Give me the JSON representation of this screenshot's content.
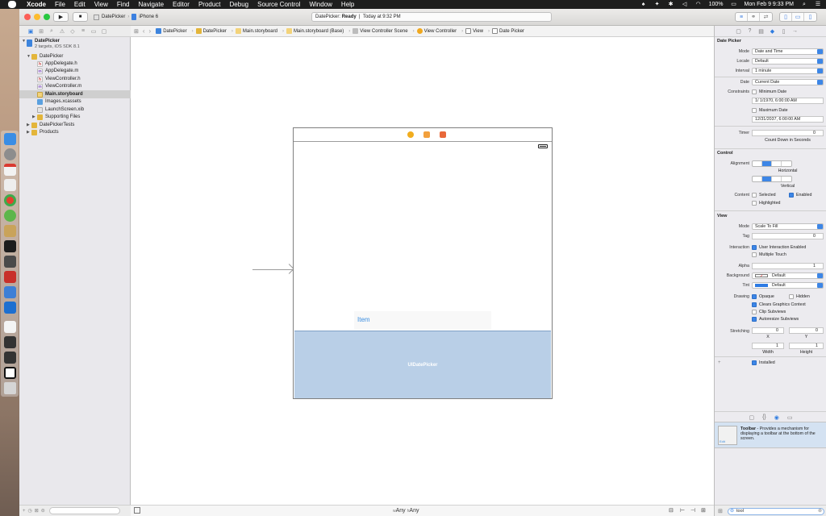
{
  "menubar": {
    "app": "Xcode",
    "items": [
      "File",
      "Edit",
      "View",
      "Find",
      "Navigate",
      "Editor",
      "Product",
      "Debug",
      "Source Control",
      "Window",
      "Help"
    ],
    "battery": "100%",
    "clock": "Mon Feb 9  9:33 PM"
  },
  "toolbar": {
    "scheme": "DatePicker",
    "device": "iPhone 6",
    "status_project": "DatePicker:",
    "status_state": "Ready",
    "status_time": "Today at 9:32 PM"
  },
  "navigator": {
    "project": {
      "name": "DatePicker",
      "subtitle": "2 targets, iOS SDK 8.1"
    },
    "items": [
      {
        "label": "DatePicker",
        "kind": "folder",
        "disclosure": "▼"
      },
      {
        "label": "AppDelegate.h",
        "kind": "h"
      },
      {
        "label": "AppDelegate.m",
        "kind": "m"
      },
      {
        "label": "ViewController.h",
        "kind": "h"
      },
      {
        "label": "ViewController.m",
        "kind": "m"
      },
      {
        "label": "Main.storyboard",
        "kind": "storyboard",
        "selected": true
      },
      {
        "label": "Images.xcassets",
        "kind": "xcassets"
      },
      {
        "label": "LaunchScreen.xib",
        "kind": "xib"
      },
      {
        "label": "Supporting Files",
        "kind": "folder",
        "disclosure": "▶"
      },
      {
        "label": "DatePickerTests",
        "kind": "folder",
        "disclosure": "▶"
      },
      {
        "label": "Products",
        "kind": "folder",
        "disclosure": "▶"
      }
    ]
  },
  "jumpbar": {
    "crumbs": [
      "DatePicker",
      "DatePicker",
      "Main.storyboard",
      "Main.storyboard (Base)",
      "View Controller Scene",
      "View Controller",
      "View",
      "Date Picker"
    ]
  },
  "canvas": {
    "item_label": "Item",
    "picker_label": "UIDatePicker",
    "size_width": "Any",
    "size_height": "Any",
    "size_width_prefix": "w",
    "size_height_prefix": "h"
  },
  "inspector": {
    "date_picker": {
      "title": "Date Picker",
      "mode_label": "Mode",
      "mode": "Date and Time",
      "locale_label": "Locale",
      "locale": "Default",
      "interval_label": "Interval",
      "interval": "1 minute",
      "date_label": "Date",
      "date": "Current Date",
      "constraints_label": "Constraints",
      "min_label": "Minimum Date",
      "min_value": "1/  1/1970,   6:00:00 AM",
      "max_label": "Maximum Date",
      "max_value": "12/31/2037,   6:00:00 AM",
      "timer_label": "Timer",
      "timer_value": "0",
      "timer_caption": "Count Down in Seconds"
    },
    "control": {
      "title": "Control",
      "alignment_label": "Alignment",
      "horizontal": "Horizontal",
      "vertical": "Vertical",
      "content_label": "Content",
      "selected": "Selected",
      "enabled": "Enabled",
      "highlighted": "Highlighted"
    },
    "view": {
      "title": "View",
      "mode_label": "Mode",
      "mode": "Scale To Fill",
      "tag_label": "Tag",
      "tag": "0",
      "interaction_label": "Interaction",
      "user_interaction": "User Interaction Enabled",
      "multiple_touch": "Multiple Touch",
      "alpha_label": "Alpha",
      "alpha": "1",
      "background_label": "Background",
      "background": "Default",
      "tint_label": "Tint",
      "tint": "Default",
      "drawing_label": "Drawing",
      "opaque": "Opaque",
      "hidden": "Hidden",
      "clears": "Clears Graphics Context",
      "clip": "Clip Subviews",
      "autoresize": "Autoresize Subviews",
      "stretching_label": "Stretching",
      "x_value": "0",
      "y_value": "0",
      "x_label": "X",
      "y_label": "Y",
      "w_value": "1",
      "h_value": "1",
      "w_label": "Width",
      "h_label": "Height",
      "installed": "Installed"
    },
    "library": {
      "item_title": "Toolbar",
      "item_desc": " - Provides a mechanism for displaying a toolbar at the bottom of the screen.",
      "icon_text": "Edit",
      "filter": "tool"
    }
  }
}
